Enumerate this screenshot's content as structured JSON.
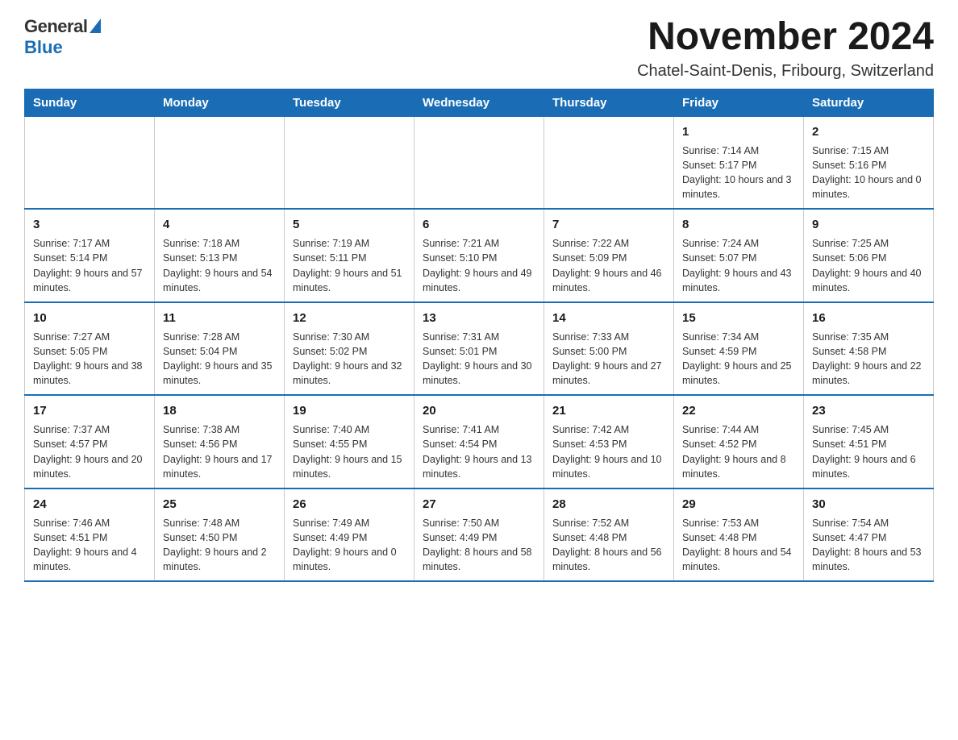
{
  "logo": {
    "general": "General",
    "blue": "Blue"
  },
  "title": "November 2024",
  "subtitle": "Chatel-Saint-Denis, Fribourg, Switzerland",
  "days_of_week": [
    "Sunday",
    "Monday",
    "Tuesday",
    "Wednesday",
    "Thursday",
    "Friday",
    "Saturday"
  ],
  "weeks": [
    [
      {
        "day": "",
        "info": ""
      },
      {
        "day": "",
        "info": ""
      },
      {
        "day": "",
        "info": ""
      },
      {
        "day": "",
        "info": ""
      },
      {
        "day": "",
        "info": ""
      },
      {
        "day": "1",
        "info": "Sunrise: 7:14 AM\nSunset: 5:17 PM\nDaylight: 10 hours and 3 minutes."
      },
      {
        "day": "2",
        "info": "Sunrise: 7:15 AM\nSunset: 5:16 PM\nDaylight: 10 hours and 0 minutes."
      }
    ],
    [
      {
        "day": "3",
        "info": "Sunrise: 7:17 AM\nSunset: 5:14 PM\nDaylight: 9 hours and 57 minutes."
      },
      {
        "day": "4",
        "info": "Sunrise: 7:18 AM\nSunset: 5:13 PM\nDaylight: 9 hours and 54 minutes."
      },
      {
        "day": "5",
        "info": "Sunrise: 7:19 AM\nSunset: 5:11 PM\nDaylight: 9 hours and 51 minutes."
      },
      {
        "day": "6",
        "info": "Sunrise: 7:21 AM\nSunset: 5:10 PM\nDaylight: 9 hours and 49 minutes."
      },
      {
        "day": "7",
        "info": "Sunrise: 7:22 AM\nSunset: 5:09 PM\nDaylight: 9 hours and 46 minutes."
      },
      {
        "day": "8",
        "info": "Sunrise: 7:24 AM\nSunset: 5:07 PM\nDaylight: 9 hours and 43 minutes."
      },
      {
        "day": "9",
        "info": "Sunrise: 7:25 AM\nSunset: 5:06 PM\nDaylight: 9 hours and 40 minutes."
      }
    ],
    [
      {
        "day": "10",
        "info": "Sunrise: 7:27 AM\nSunset: 5:05 PM\nDaylight: 9 hours and 38 minutes."
      },
      {
        "day": "11",
        "info": "Sunrise: 7:28 AM\nSunset: 5:04 PM\nDaylight: 9 hours and 35 minutes."
      },
      {
        "day": "12",
        "info": "Sunrise: 7:30 AM\nSunset: 5:02 PM\nDaylight: 9 hours and 32 minutes."
      },
      {
        "day": "13",
        "info": "Sunrise: 7:31 AM\nSunset: 5:01 PM\nDaylight: 9 hours and 30 minutes."
      },
      {
        "day": "14",
        "info": "Sunrise: 7:33 AM\nSunset: 5:00 PM\nDaylight: 9 hours and 27 minutes."
      },
      {
        "day": "15",
        "info": "Sunrise: 7:34 AM\nSunset: 4:59 PM\nDaylight: 9 hours and 25 minutes."
      },
      {
        "day": "16",
        "info": "Sunrise: 7:35 AM\nSunset: 4:58 PM\nDaylight: 9 hours and 22 minutes."
      }
    ],
    [
      {
        "day": "17",
        "info": "Sunrise: 7:37 AM\nSunset: 4:57 PM\nDaylight: 9 hours and 20 minutes."
      },
      {
        "day": "18",
        "info": "Sunrise: 7:38 AM\nSunset: 4:56 PM\nDaylight: 9 hours and 17 minutes."
      },
      {
        "day": "19",
        "info": "Sunrise: 7:40 AM\nSunset: 4:55 PM\nDaylight: 9 hours and 15 minutes."
      },
      {
        "day": "20",
        "info": "Sunrise: 7:41 AM\nSunset: 4:54 PM\nDaylight: 9 hours and 13 minutes."
      },
      {
        "day": "21",
        "info": "Sunrise: 7:42 AM\nSunset: 4:53 PM\nDaylight: 9 hours and 10 minutes."
      },
      {
        "day": "22",
        "info": "Sunrise: 7:44 AM\nSunset: 4:52 PM\nDaylight: 9 hours and 8 minutes."
      },
      {
        "day": "23",
        "info": "Sunrise: 7:45 AM\nSunset: 4:51 PM\nDaylight: 9 hours and 6 minutes."
      }
    ],
    [
      {
        "day": "24",
        "info": "Sunrise: 7:46 AM\nSunset: 4:51 PM\nDaylight: 9 hours and 4 minutes."
      },
      {
        "day": "25",
        "info": "Sunrise: 7:48 AM\nSunset: 4:50 PM\nDaylight: 9 hours and 2 minutes."
      },
      {
        "day": "26",
        "info": "Sunrise: 7:49 AM\nSunset: 4:49 PM\nDaylight: 9 hours and 0 minutes."
      },
      {
        "day": "27",
        "info": "Sunrise: 7:50 AM\nSunset: 4:49 PM\nDaylight: 8 hours and 58 minutes."
      },
      {
        "day": "28",
        "info": "Sunrise: 7:52 AM\nSunset: 4:48 PM\nDaylight: 8 hours and 56 minutes."
      },
      {
        "day": "29",
        "info": "Sunrise: 7:53 AM\nSunset: 4:48 PM\nDaylight: 8 hours and 54 minutes."
      },
      {
        "day": "30",
        "info": "Sunrise: 7:54 AM\nSunset: 4:47 PM\nDaylight: 8 hours and 53 minutes."
      }
    ]
  ]
}
